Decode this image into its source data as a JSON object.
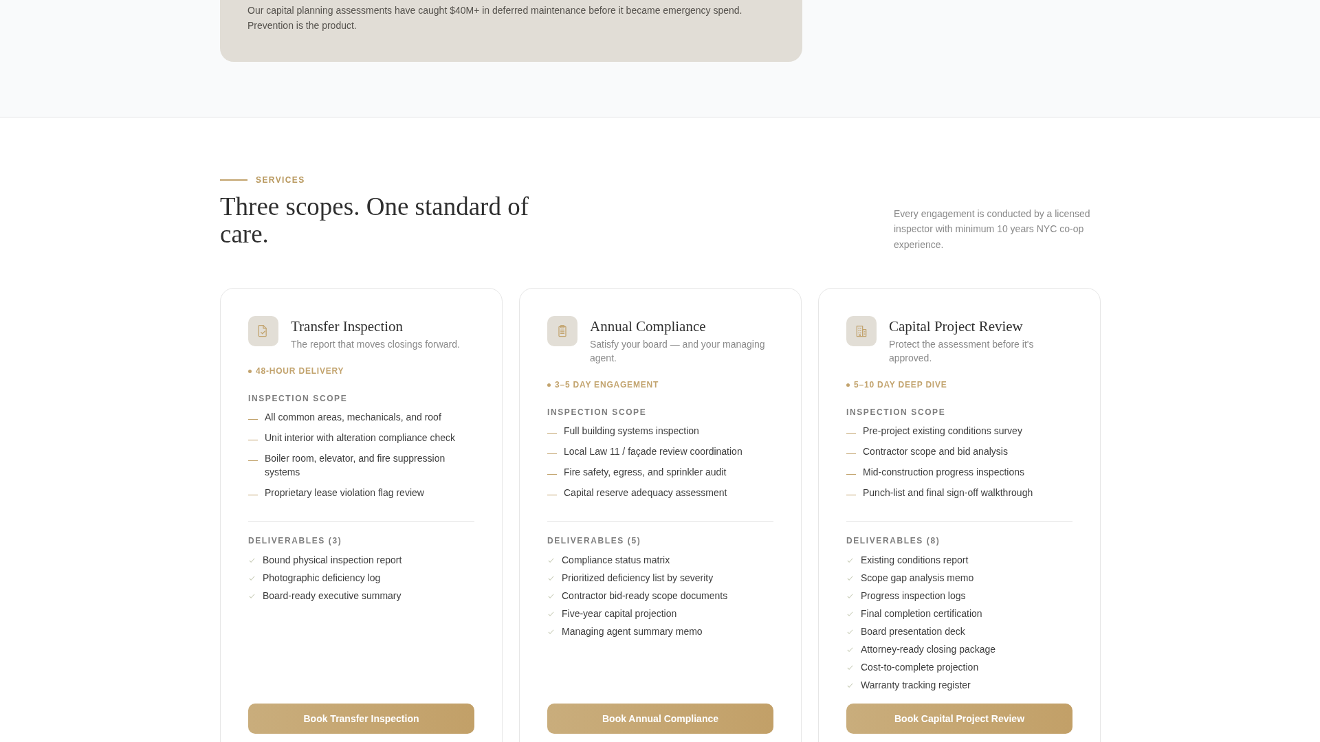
{
  "intro_card": {
    "text": "Our capital planning assessments have caught $40M+ in deferred maintenance before it became emergency spend. Prevention is the product."
  },
  "services": {
    "eyebrow": "SERVICES",
    "heading": "Three scopes. One standard of care.",
    "note": "Every engagement is conducted by a licensed inspector with minimum 10 years NYC co-op experience.",
    "cards": [
      {
        "kind": "document",
        "title": "Transfer Inspection",
        "subtitle": "The report that moves closings forward.",
        "badge": "48-HOUR DELIVERY",
        "scope_label": "INSPECTION SCOPE",
        "scope": [
          "All common areas, mechanicals, and roof",
          "Unit interior with alteration compliance check",
          "Boiler room, elevator, and fire suppression systems",
          "Proprietary lease violation flag review"
        ],
        "deliverables_label": "DELIVERABLES (3)",
        "deliverables": [
          "Bound physical inspection report",
          "Photographic deficiency log",
          "Board-ready executive summary"
        ],
        "button": "Book Transfer Inspection"
      },
      {
        "kind": "clipboard",
        "title": "Annual Compliance",
        "subtitle": "Satisfy your board — and your managing agent.",
        "badge": "3–5 DAY ENGAGEMENT",
        "scope_label": "INSPECTION SCOPE",
        "scope": [
          "Full building systems inspection",
          "Local Law 11 / façade review coordination",
          "Fire safety, egress, and sprinkler audit",
          "Capital reserve adequacy assessment"
        ],
        "deliverables_label": "DELIVERABLES (5)",
        "deliverables": [
          "Compliance status matrix",
          "Prioritized deficiency list by severity",
          "Contractor bid-ready scope documents",
          "Five-year capital projection",
          "Managing agent summary memo"
        ],
        "button": "Book Annual Compliance"
      },
      {
        "kind": "building",
        "title": "Capital Project Review",
        "subtitle": "Protect the assessment before it's approved.",
        "badge": "5–10 DAY DEEP DIVE",
        "scope_label": "INSPECTION SCOPE",
        "scope": [
          "Pre-project existing conditions survey",
          "Contractor scope and bid analysis",
          "Mid-construction progress inspections",
          "Punch-list and final sign-off walkthrough"
        ],
        "deliverables_label": "DELIVERABLES (8)",
        "deliverables": [
          "Existing conditions report",
          "Scope gap analysis memo",
          "Progress inspection logs",
          "Final completion certification",
          "Board presentation deck",
          "Attorney-ready closing package",
          "Cost-to-complete projection",
          "Warranty tracking register"
        ],
        "button": "Book Capital Project Review"
      }
    ]
  }
}
